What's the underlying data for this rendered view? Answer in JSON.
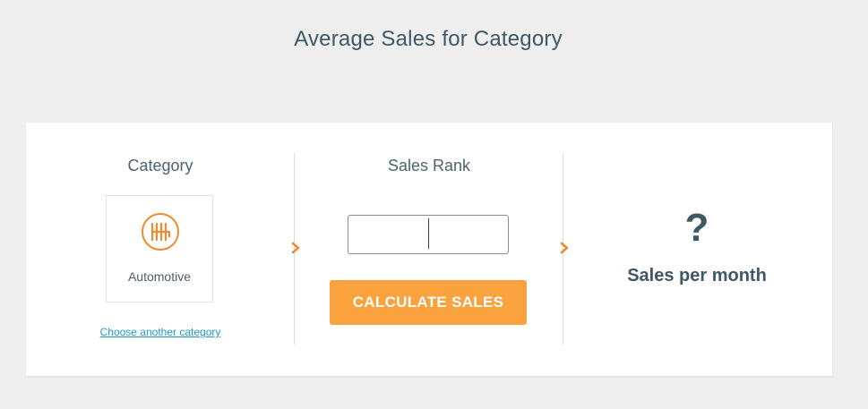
{
  "page": {
    "title": "Average Sales for Category"
  },
  "category": {
    "heading": "Category",
    "selected": "Automotive",
    "icon": "gear-shift-icon",
    "change_link": "Choose another category"
  },
  "rank": {
    "heading": "Sales Rank",
    "input_value": "",
    "button_label": "CALCULATE SALES"
  },
  "result": {
    "value": "?",
    "label": "Sales per month"
  },
  "colors": {
    "accent": "#f9a23e",
    "title_text": "#3f5866",
    "link": "#1c9bc4",
    "background": "#efefef",
    "card": "#ffffff"
  }
}
